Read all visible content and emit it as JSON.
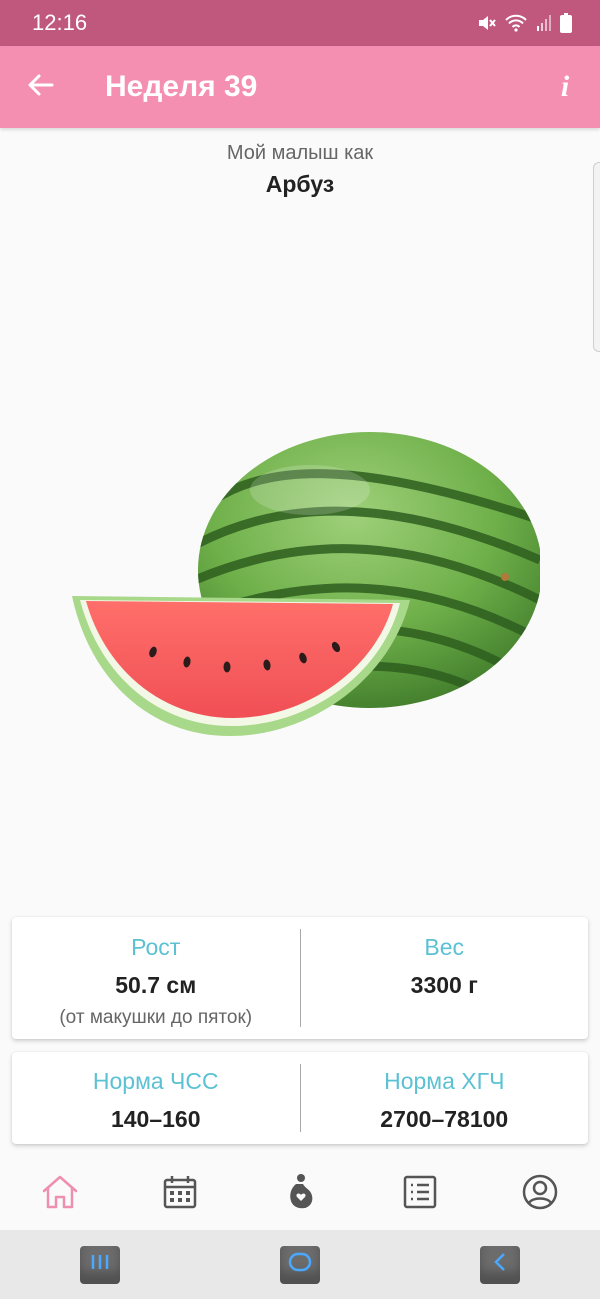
{
  "status_bar": {
    "time": "12:16"
  },
  "app_bar": {
    "title": "Неделя 39",
    "info_label": "i"
  },
  "headline": {
    "subtitle": "Мой малыш как",
    "fruit_name": "Арбуз"
  },
  "stats_card_1": {
    "height_label": "Рост",
    "height_value": "50.7 см",
    "height_note": "(от макушки до пяток)",
    "weight_label": "Вес",
    "weight_value": "3300 г"
  },
  "stats_card_2": {
    "hr_label": "Норма ЧСС",
    "hr_value": "140–160",
    "hcg_label": "Норма ХГЧ",
    "hcg_value": "2700–78100"
  },
  "bottom_nav": {
    "items": [
      "home-icon",
      "calendar-icon",
      "pregnancy-icon",
      "checklist-icon",
      "profile-icon"
    ],
    "active": "home-icon"
  },
  "colors": {
    "status_bar": "#c0587e",
    "app_bar": "#f48fb1",
    "accent_label": "#5bc1d3",
    "nav_active": "#ef8fb0",
    "nav_inactive": "#555555"
  }
}
